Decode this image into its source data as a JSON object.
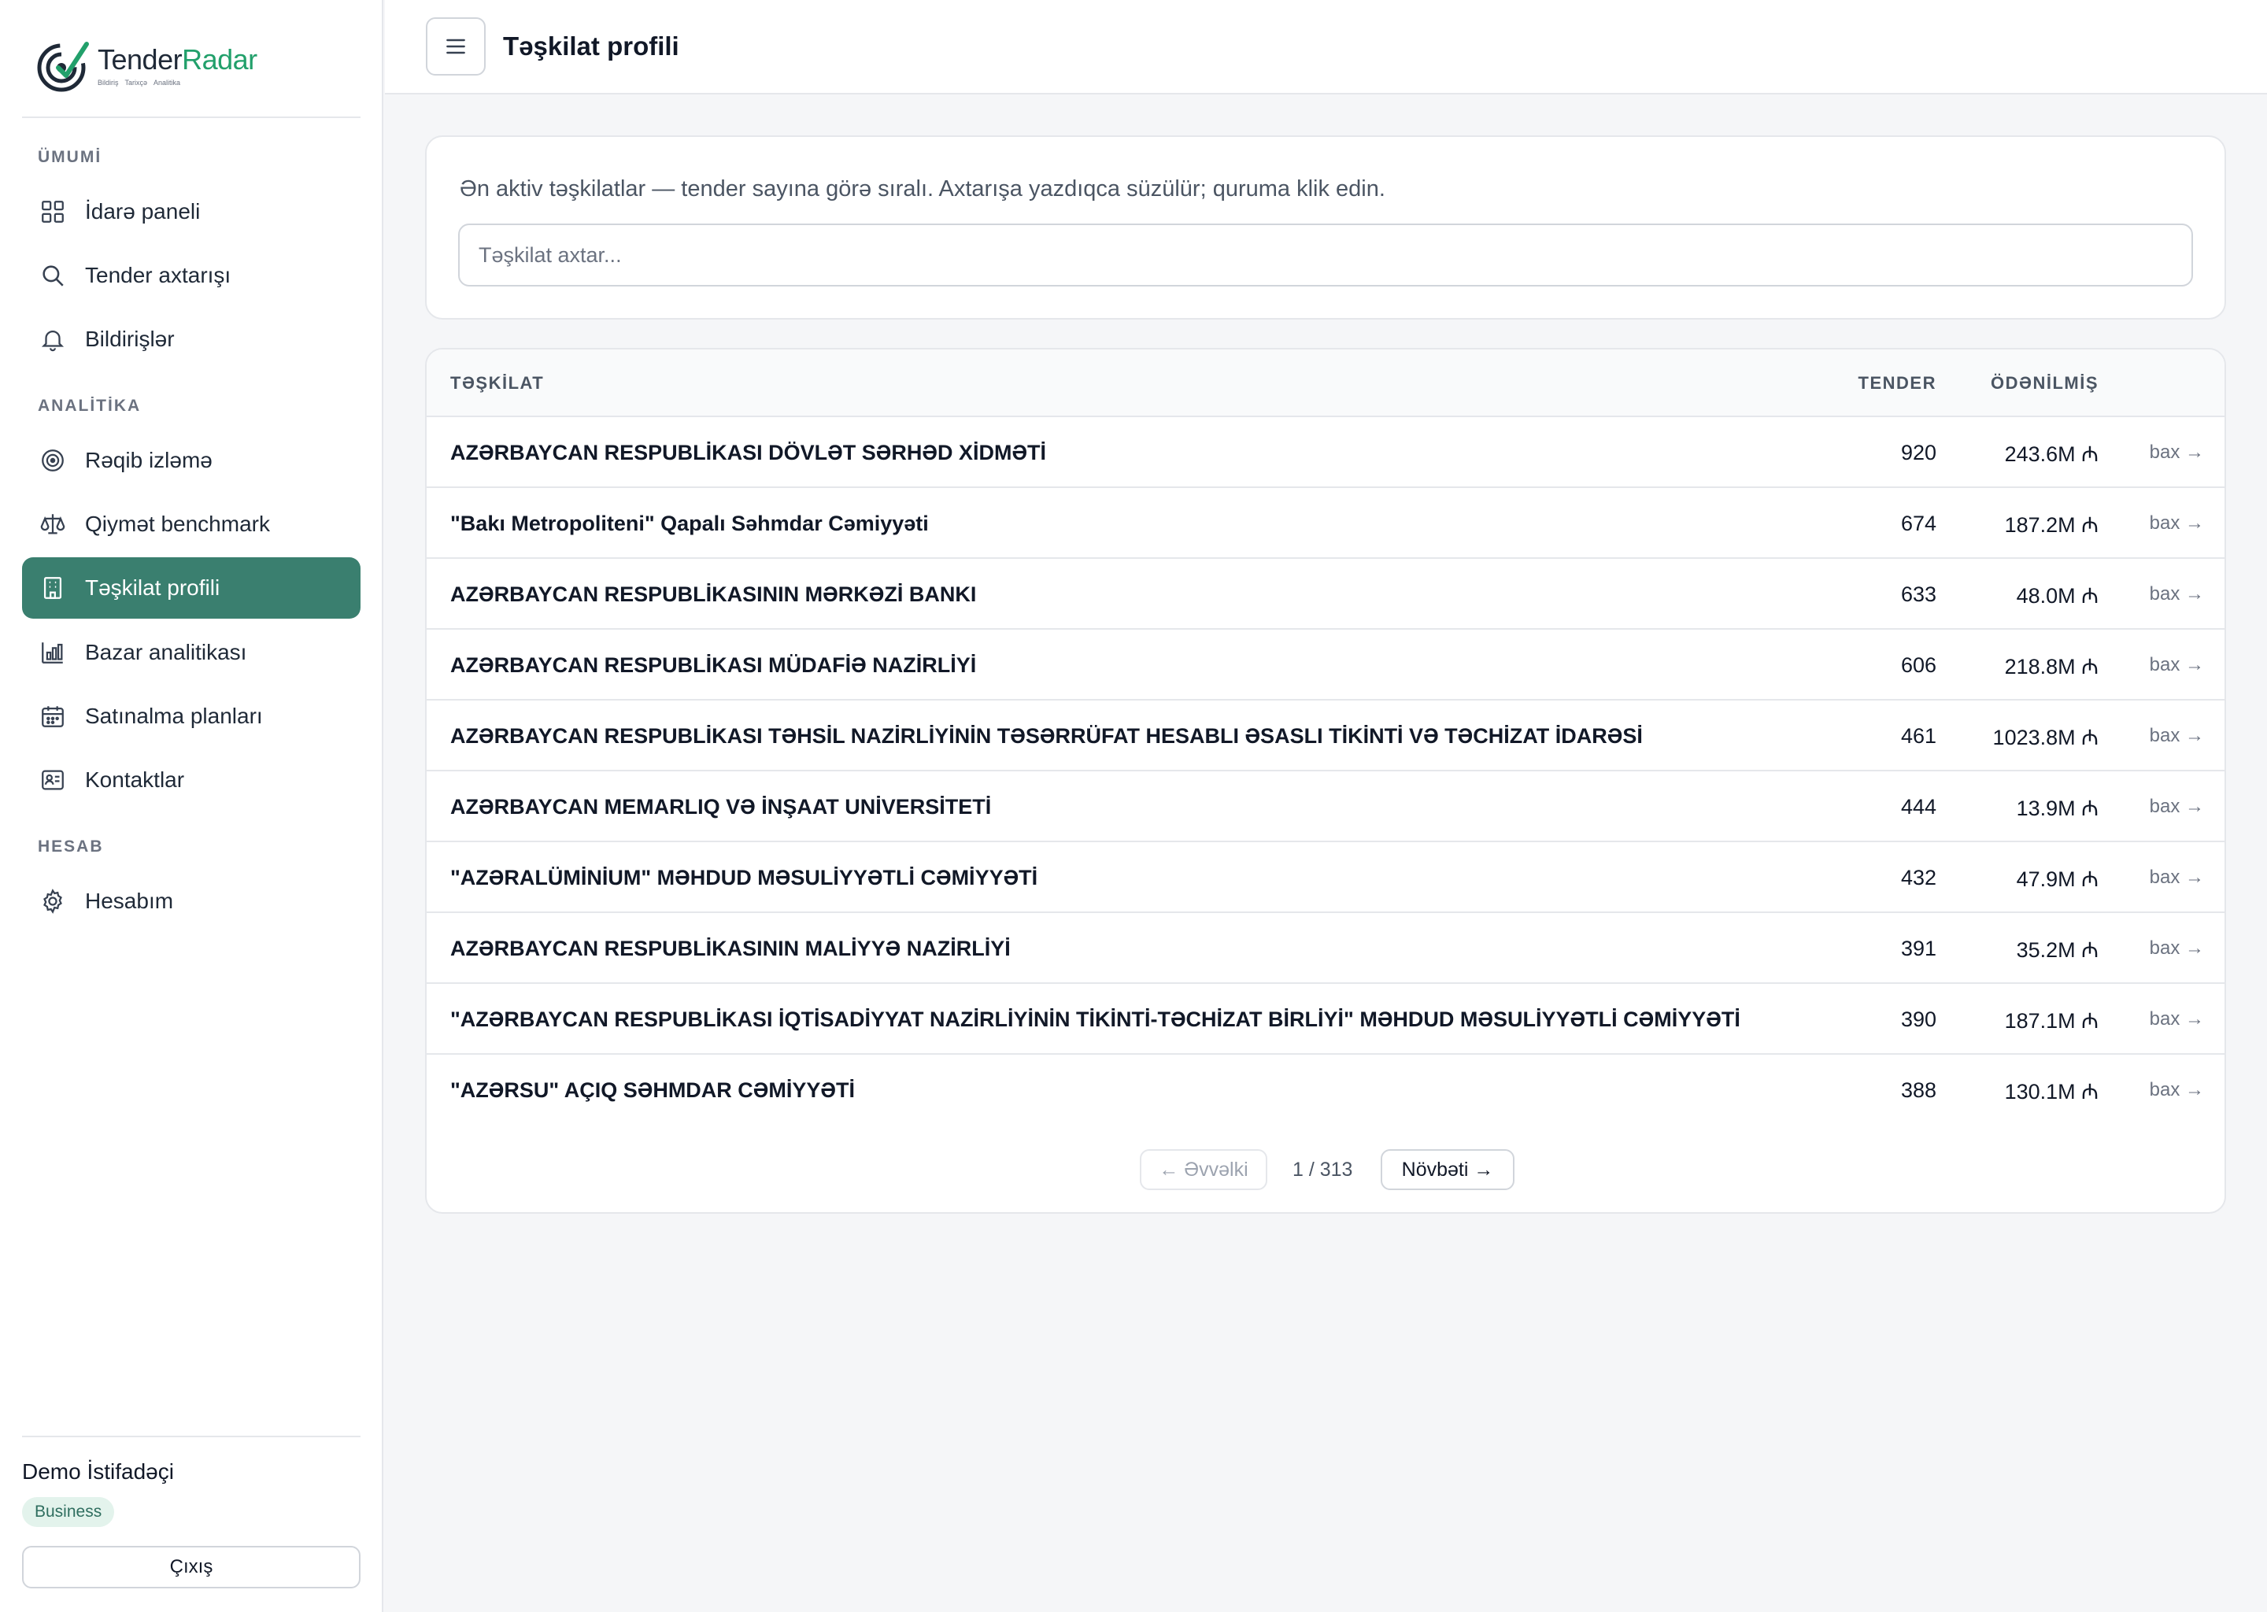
{
  "brand": {
    "name_part1": "Tender",
    "name_part2": "Radar",
    "tagline": [
      "Bildiriş",
      "Tarixçə",
      "Analitika"
    ],
    "accent": "#22a06b"
  },
  "sidebar": {
    "sections": [
      {
        "label": "ÜMUMİ",
        "items": [
          {
            "label": "İdarə paneli",
            "icon": "dashboard-icon"
          },
          {
            "label": "Tender axtarışı",
            "icon": "search-icon"
          },
          {
            "label": "Bildirişlər",
            "icon": "bell-icon"
          }
        ]
      },
      {
        "label": "ANALİTİKA",
        "items": [
          {
            "label": "Rəqib izləmə",
            "icon": "target-icon"
          },
          {
            "label": "Qiymət benchmark",
            "icon": "scale-icon"
          },
          {
            "label": "Təşkilat profili",
            "icon": "building-icon",
            "active": true
          },
          {
            "label": "Bazar analitikası",
            "icon": "bar-chart-icon"
          },
          {
            "label": "Satınalma planları",
            "icon": "calendar-icon"
          },
          {
            "label": "Kontaktlar",
            "icon": "contact-card-icon"
          }
        ]
      },
      {
        "label": "HESAB",
        "items": [
          {
            "label": "Hesabım",
            "icon": "gear-icon"
          }
        ]
      }
    ],
    "user": {
      "name": "Demo İstifadəçi",
      "plan": "Business",
      "logout_label": "Çıxış"
    },
    "active_color": "#3a7f6f"
  },
  "header": {
    "title": "Təşkilat profili"
  },
  "search": {
    "description": "Ən aktiv təşkilatlar — tender sayına görə sıralı. Axtarışa yazdıqca süzülür; quruma klik edin.",
    "placeholder": "Təşkilat axtar...",
    "value": ""
  },
  "table": {
    "columns": {
      "org": "TƏŞKİLAT",
      "tender": "TENDER",
      "paid": "ÖDƏNİLMİŞ"
    },
    "view_label": "bax →",
    "rows": [
      {
        "name": "AZƏRBAYCAN RESPUBLİKASI DÖVLƏT SƏRHƏD XİDMƏTİ",
        "tender": "920",
        "paid": "243.6M ₼"
      },
      {
        "name": "\"Bakı Metropoliteni\" Qapalı Səhmdar Cəmiyyəti",
        "tender": "674",
        "paid": "187.2M ₼"
      },
      {
        "name": "AZƏRBAYCAN RESPUBLİKASININ MƏRKƏZİ BANKI",
        "tender": "633",
        "paid": "48.0M ₼"
      },
      {
        "name": "AZƏRBAYCAN RESPUBLİKASI MÜDAFİƏ NAZİRLİYİ",
        "tender": "606",
        "paid": "218.8M ₼"
      },
      {
        "name": "AZƏRBAYCAN RESPUBLİKASI TƏHSİL NAZİRLİYİNİN TƏSƏRRÜFAT HESABLI ƏSASLI TİKİNTİ VƏ TƏCHİZAT İDARƏSİ",
        "tender": "461",
        "paid": "1023.8M ₼"
      },
      {
        "name": "AZƏRBAYCAN MEMARLIQ VƏ İNŞAAT UNİVERSİTETİ",
        "tender": "444",
        "paid": "13.9M ₼"
      },
      {
        "name": "\"AZƏRALÜMİNİUM\" MƏHDUD MƏSULİYYƏTLİ CƏMİYYƏTİ",
        "tender": "432",
        "paid": "47.9M ₼"
      },
      {
        "name": "AZƏRBAYCAN RESPUBLİKASININ MALİYYƏ NAZİRLİYİ",
        "tender": "391",
        "paid": "35.2M ₼"
      },
      {
        "name": "\"AZƏRBAYCAN RESPUBLİKASI İQTİSADİYYAT NAZİRLİYİNİN TİKİNTİ-TƏCHİZAT BİRLİYİ\" MƏHDUD MƏSULİYYƏTLİ CƏMİYYƏTİ",
        "tender": "390",
        "paid": "187.1M ₼"
      },
      {
        "name": "\"AZƏRSU\" AÇIQ SƏHMDAR CƏMİYYƏTİ",
        "tender": "388",
        "paid": "130.1M ₼"
      }
    ]
  },
  "pagination": {
    "prev_label": "← Əvvəlki",
    "info": "1 / 313",
    "next_label": "Növbəti →"
  }
}
